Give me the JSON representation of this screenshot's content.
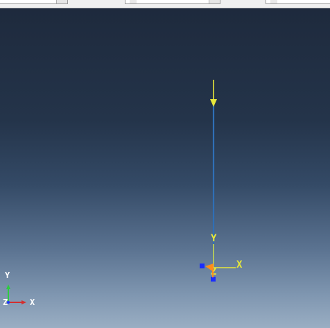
{
  "toolbar": {
    "combos": [
      "",
      "",
      ""
    ]
  },
  "viewport": {
    "model_triad": {
      "x_label": "X",
      "y_label": "Y",
      "z_label": "Z"
    },
    "view_triad": {
      "x_label": "X",
      "y_label": "Y",
      "z_label": "Z"
    },
    "colors": {
      "background_top": "#1e2a3d",
      "background_bottom": "#9aaec3",
      "beam": "#2f6fb6",
      "load": "#e8e83a",
      "triad_x": "#d32f2f",
      "triad_y": "#2ecc40",
      "triad_z": "#1a3cff",
      "bc_orange": "#ff8c1a",
      "bc_blue": "#1a2cff"
    }
  }
}
